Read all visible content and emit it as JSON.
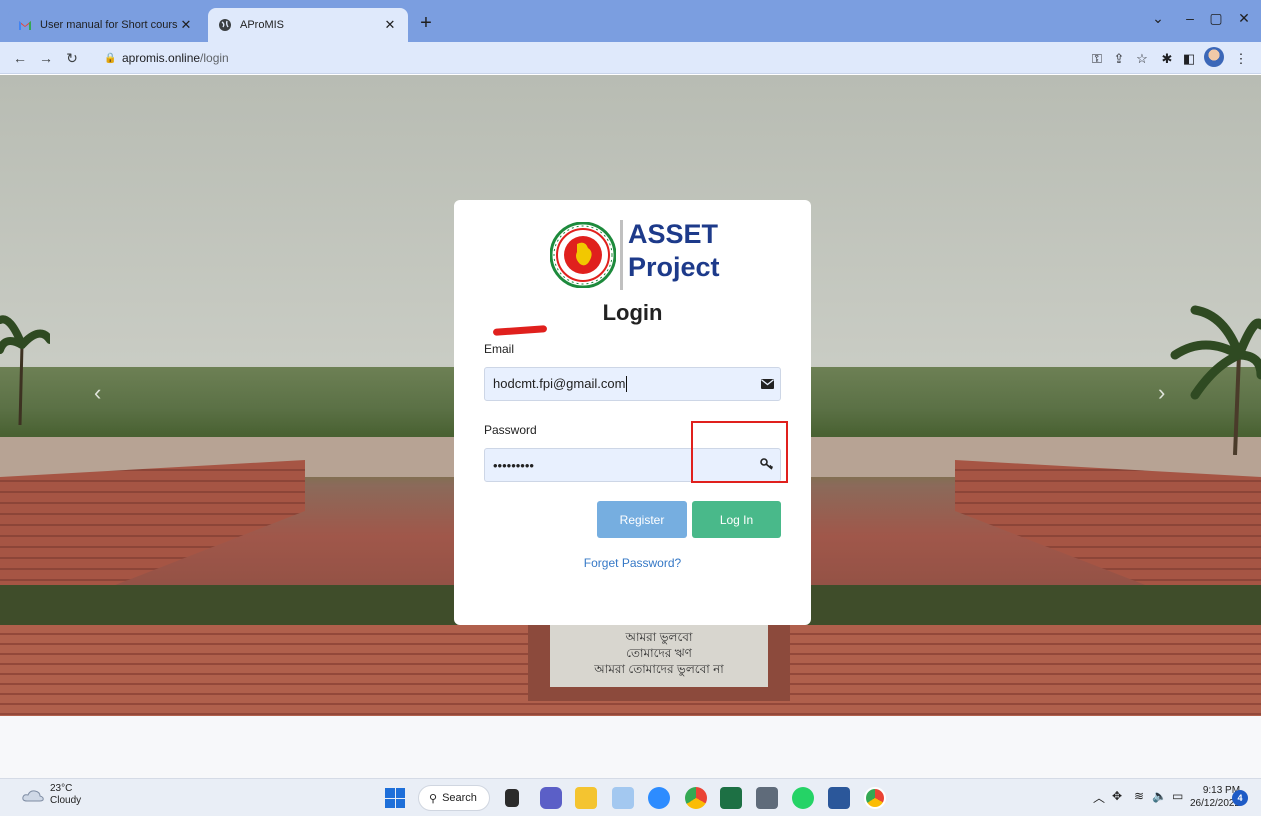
{
  "browser": {
    "tabs": [
      {
        "title": "User manual for Short course Elig",
        "active": false
      },
      {
        "title": "AProMIS",
        "active": true
      }
    ],
    "url_host": "apromis.online",
    "url_path": "/login"
  },
  "login": {
    "logo_line1": "ASSET",
    "logo_line2": "Project",
    "title": "Login",
    "email_label": "Email",
    "email_value": "hodcmt.fpi@gmail.com",
    "password_label": "Password",
    "password_value": "•••••••••",
    "register_label": "Register",
    "login_label": "Log In",
    "forgot_label": "Forget Password?"
  },
  "background": {
    "plaque_lines": [
      "আমরা ভুলবো",
      "তোমাদের ঋণ",
      "আমরা তোমাদের ভুলবো না"
    ]
  },
  "taskbar": {
    "weather_temp": "23°C",
    "weather_desc": "Cloudy",
    "search_label": "Search",
    "time": "9:13 PM",
    "date": "26/12/2022",
    "notification_count": "4"
  },
  "colors": {
    "register_button": "#76aee0",
    "login_button": "#49b98a",
    "link": "#3578c6",
    "highlight": "#e0201d",
    "logo_text": "#1d3a8a"
  }
}
